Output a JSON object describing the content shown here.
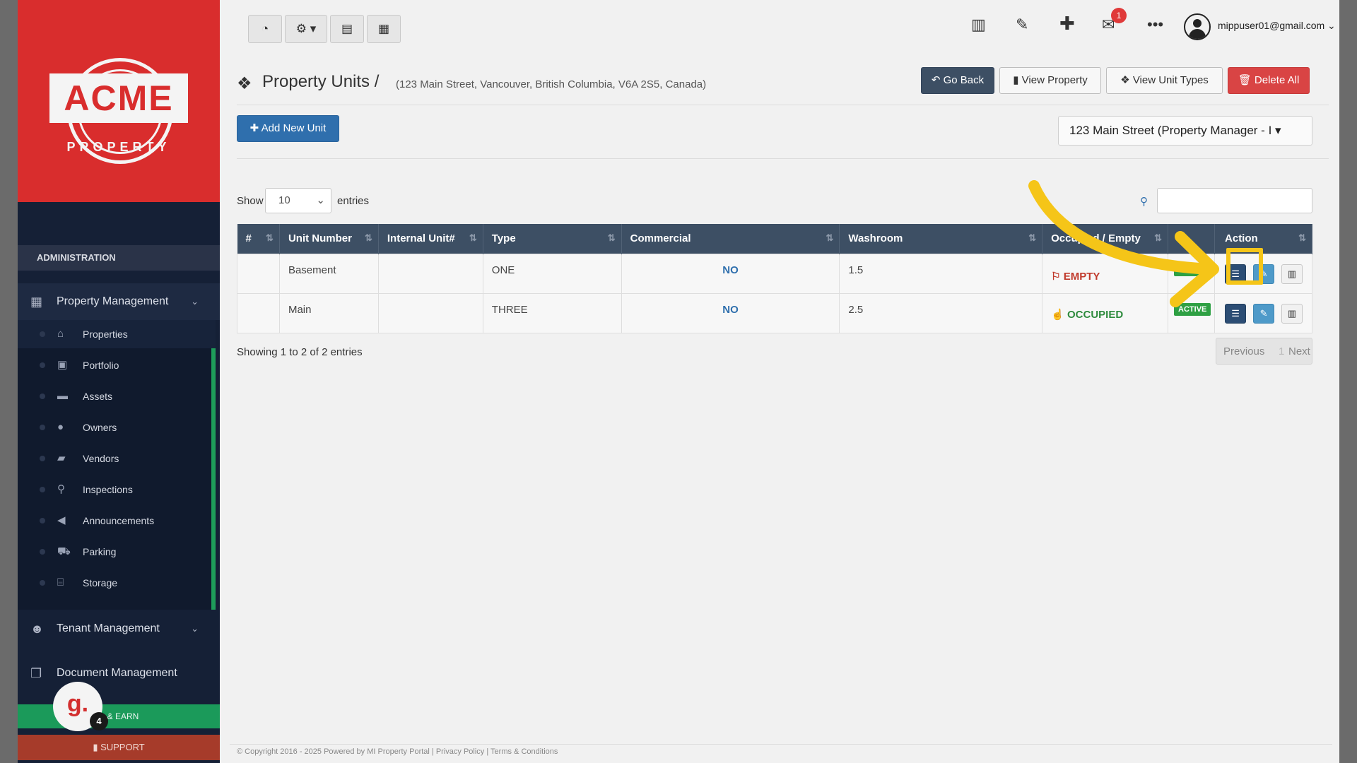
{
  "sidebar": {
    "logo_text": "ACME",
    "logo_sub": "PROPERTY",
    "section_label": "ADMINISTRATION",
    "property_management": "Property Management",
    "items": [
      {
        "label": "Properties",
        "icon": "home-icon"
      },
      {
        "label": "Portfolio",
        "icon": "portfolio-icon"
      },
      {
        "label": "Assets",
        "icon": "assets-icon"
      },
      {
        "label": "Owners",
        "icon": "user-icon"
      },
      {
        "label": "Vendors",
        "icon": "briefcase-icon"
      },
      {
        "label": "Inspections",
        "icon": "search-icon"
      },
      {
        "label": "Announcements",
        "icon": "megaphone-icon"
      },
      {
        "label": "Parking",
        "icon": "car-icon"
      },
      {
        "label": "Storage",
        "icon": "storage-icon"
      }
    ],
    "tenant_management": "Tenant Management",
    "document_management": "Document Management",
    "refer_label": "R & EARN",
    "support_label": "SUPPORT",
    "g_badge": "g.",
    "g_count": "4"
  },
  "topbar": {
    "mail_count": "1",
    "user_email": "mippuser01@gmail.com"
  },
  "header": {
    "title": "Property Units",
    "separator": "/",
    "address": "(123 Main Street, Vancouver, British Columbia, V6A 2S5, Canada)",
    "go_back": "Go Back",
    "view_property": "View Property",
    "view_unit_types": "View Unit Types",
    "delete_all": "Delete All"
  },
  "toolbar": {
    "add_unit": "Add New Unit",
    "property_select": "123 Main Street (Property Manager - I"
  },
  "table_controls": {
    "show": "Show",
    "entries_value": "10",
    "entries": "entries"
  },
  "table": {
    "columns": [
      "#",
      "Unit Number",
      "Internal Unit#",
      "Type",
      "Commercial",
      "Washroom",
      "Occupied / Empty",
      "",
      "Action"
    ],
    "rows": [
      {
        "num": "",
        "unit": "Basement",
        "internal": "",
        "type": "ONE",
        "commercial": "NO",
        "washroom": "1.5",
        "status": "EMPTY",
        "state": "ACTIVE"
      },
      {
        "num": "",
        "unit": "Main",
        "internal": "",
        "type": "THREE",
        "commercial": "NO",
        "washroom": "2.5",
        "status": "OCCUPIED",
        "state": "ACTIVE"
      }
    ],
    "info": "Showing 1 to 2 of 2 entries",
    "prev": "Previous",
    "page": "1",
    "next": "Next"
  },
  "footer": {
    "copyright": "© Copyright 2016 - 2025 Powered by MI Property Portal | Privacy Policy | Terms & Conditions"
  },
  "colors": {
    "accent": "#f5c518",
    "sidebar": "#152036",
    "brand_red": "#d92d2d",
    "header": "#3d4f64"
  }
}
